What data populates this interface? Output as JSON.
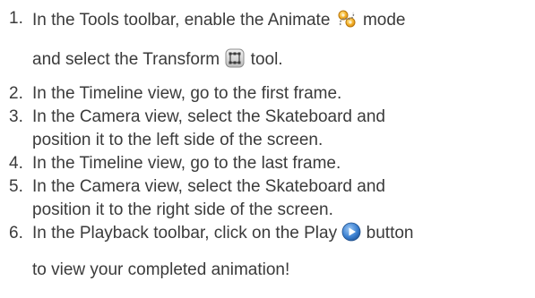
{
  "steps": [
    {
      "number": "1.",
      "line1_a": "In the Tools toolbar, enable the Animate",
      "line1_b": "mode",
      "line2_a": "and select the Transform",
      "line2_b": "tool.",
      "icons": [
        "animate-mode-icon",
        "transform-tool-icon"
      ]
    },
    {
      "number": "2.",
      "line1": "In the Timeline view, go to the first frame."
    },
    {
      "number": "3.",
      "line1": "In the Camera view, select the Skateboard and",
      "line2": "position it to the left side of the screen."
    },
    {
      "number": "4.",
      "line1": "In the Timeline view, go to the last frame."
    },
    {
      "number": "5.",
      "line1": "In the Camera view, select the Skateboard and",
      "line2": "position it to the right side of the screen."
    },
    {
      "number": "6.",
      "line1_a": "In the Playback toolbar, click on the Play",
      "line1_b": "button",
      "line2": "to view your completed animation!",
      "icons": [
        "play-button-icon"
      ]
    }
  ],
  "colors": {
    "text": "#3b3b3b",
    "animate_icon": "#f0a51c",
    "play_icon": "#3a7fd0"
  }
}
